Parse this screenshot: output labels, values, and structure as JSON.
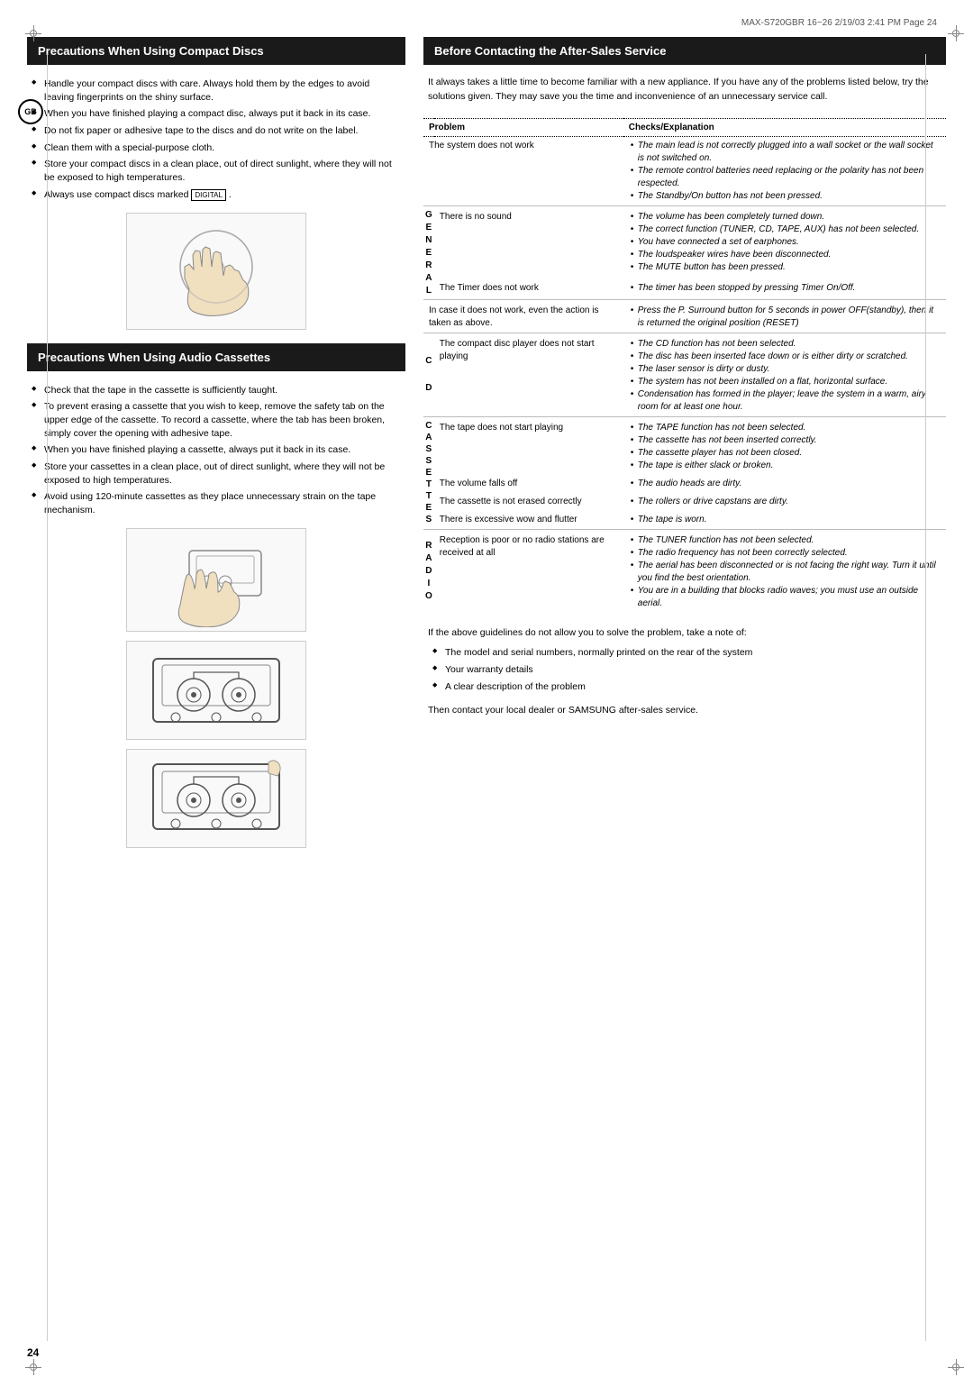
{
  "header": {
    "text": "MAX-S720GBR 16~26  2/19/03 2:41 PM  Page 24"
  },
  "gb_badge": "GB",
  "left": {
    "section1": {
      "title": "Precautions When Using Compact Discs",
      "bullets": [
        "Handle your compact discs with care. Always hold them by the edges to avoid leaving fingerprints on the shiny surface.",
        "When you have finished playing a compact disc, always put it back in its case.",
        "Do not fix paper or adhesive tape to the discs and do not write on the label.",
        "Clean them with a special-purpose cloth.",
        "Store your compact discs in a clean place, out of direct sunlight, where they will not be exposed to high temperatures.",
        "Always use compact discs marked [logo]."
      ]
    },
    "section2": {
      "title": "Precautions When Using Audio Cassettes",
      "bullets": [
        "Check that the tape in the cassette is sufficiently taught.",
        "To prevent erasing a cassette that you wish to keep, remove the safety tab on the upper edge of the cassette. To record a cassette, where the tab has been broken, simply cover the opening with adhesive tape.",
        "When you have finished playing a cassette, always put it back in its case.",
        "Store your cassettes in a clean place, out of direct sunlight, where they will not be exposed to high temperatures.",
        "Avoid using 120-minute cassettes as they place unnecessary strain on the tape mechanism."
      ]
    }
  },
  "right": {
    "section_title": "Before Contacting the After-Sales Service",
    "intro": "It always takes a little time to become familiar with a new appliance. If you have any of the problems listed below, try the solutions given. They may save you the time and inconvenience of an unnecessary service call.",
    "table": {
      "col_problem": "Problem",
      "col_checks": "Checks/Explanation",
      "rows": [
        {
          "category": "",
          "problem": "The system does not work",
          "checks": [
            "The main lead is not correctly plugged into a wall socket or the wall socket is not switched on.",
            "The remote control batteries need replacing or the polarity has not been respected.",
            "The Standby/On button has not been pressed."
          ]
        },
        {
          "category": "GENERAL",
          "problem": "There is no sound",
          "checks": [
            "The volume has been completely turned down.",
            "The correct function (TUNER, CD, TAPE, AUX) has not been selected.",
            "You have connected a set of earphones.",
            "The loudspeaker wires have been disconnected.",
            "The MUTE button has been pressed."
          ]
        },
        {
          "category": "",
          "problem": "The Timer does not work",
          "checks": [
            "The timer has been stopped by pressing Timer On/Off."
          ]
        },
        {
          "category": "",
          "problem": "In case it does not work, even the action is taken as above.",
          "checks": [
            "Press the P. Surround button for 5 seconds in power OFF(standby), then it is returned the original position (RESET)"
          ]
        },
        {
          "category": "CD",
          "problem": "The compact disc player does not start playing",
          "checks": [
            "The CD function has not been selected.",
            "The disc has been inserted face down or is either dirty or scratched.",
            "The laser sensor is dirty or dusty.",
            "The system has not been installed on a flat, horizontal surface.",
            "Condensation has formed in the player; leave the system in a warm, airy room for at least one hour."
          ]
        },
        {
          "category": "CASSETTE",
          "problem": "The tape does not start playing",
          "checks": [
            "The TAPE function has not been selected.",
            "The cassette has not been inserted correctly.",
            "The cassette player has not been closed.",
            "The tape is either slack or broken."
          ]
        },
        {
          "category": "",
          "problem": "The volume falls off",
          "checks": [
            "The audio heads are dirty."
          ]
        },
        {
          "category": "",
          "problem": "The cassette is not erased correctly",
          "checks": [
            "The rollers or drive capstans are dirty."
          ]
        },
        {
          "category": "",
          "problem": "There is excessive wow and flutter",
          "checks": [
            "The tape is worn."
          ]
        },
        {
          "category": "RADIO",
          "problem": "Reception is poor or no radio stations are received at all",
          "checks": [
            "The TUNER function has not been selected.",
            "The radio frequency has not been correctly selected.",
            "The aerial has been disconnected or is not facing the right way. Turn it until you find the best orientation.",
            "You are in a building that blocks radio waves; you must use an outside aerial."
          ]
        }
      ]
    },
    "bottom": {
      "intro": "If the above guidelines do not allow you to solve the problem, take a note of:",
      "bullets": [
        "The model and serial numbers, normally printed on the rear of the system",
        "Your warranty details",
        "A clear description of the problem"
      ],
      "outro": "Then contact your local dealer or SAMSUNG after-sales service."
    }
  },
  "page_number": "24"
}
